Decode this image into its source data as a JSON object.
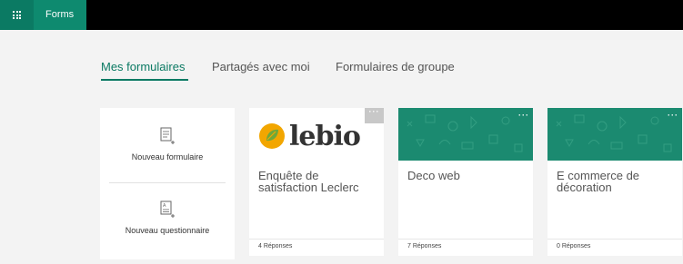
{
  "app": {
    "name": "Forms"
  },
  "tabs": [
    {
      "label": "Mes formulaires"
    },
    {
      "label": "Partagés avec moi"
    },
    {
      "label": "Formulaires de groupe"
    }
  ],
  "create": {
    "new_form_label": "Nouveau formulaire",
    "new_quiz_label": "Nouveau questionnaire"
  },
  "logo": {
    "text": "lebio"
  },
  "forms": [
    {
      "title": "Enquête de satisfaction Leclerc",
      "responses": "4 Réponses",
      "thumbnail": "lebio-logo"
    },
    {
      "title": "Deco web",
      "responses": "7 Réponses",
      "thumbnail": "green-pattern"
    },
    {
      "title": "E commerce de décoration",
      "responses": "0 Réponses",
      "thumbnail": "green-pattern"
    }
  ],
  "colors": {
    "accent": "#0b7a63",
    "card_header_green": "#1b8a70",
    "topbar": "#000000"
  },
  "icons": {
    "more": "more-dots-icon",
    "waffle": "waffle-icon",
    "new_form": "new-form-icon",
    "new_quiz": "new-quiz-icon"
  }
}
